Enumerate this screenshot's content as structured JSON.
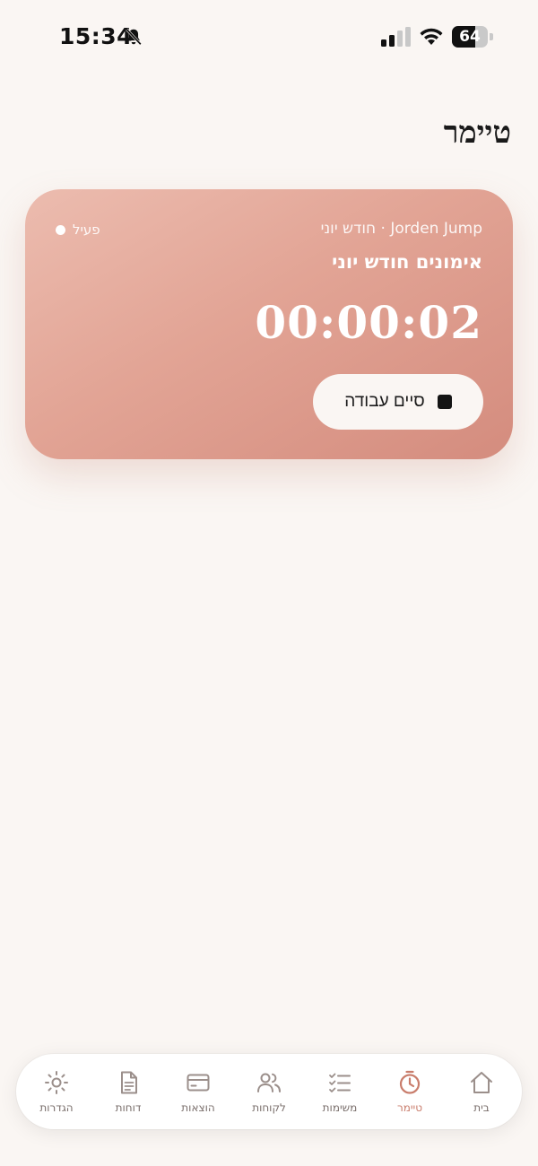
{
  "status_bar": {
    "time": "15:34",
    "battery_percent": 64,
    "battery_label": "64",
    "icons": [
      "bell-slash-icon",
      "cellular-signal-icon",
      "wifi-icon",
      "battery-icon"
    ]
  },
  "page": {
    "title": "טיימר"
  },
  "timer_card": {
    "status_label": "פעיל",
    "subtitle": "Jorden Jump · חודש יוני",
    "title": "אימונים חודש יוני",
    "elapsed": "00:00:02",
    "stop_button_label": "סיים עבודה",
    "stop_icon": "stop-icon"
  },
  "nav": {
    "items": [
      {
        "label": "בית",
        "icon": "home-icon",
        "active": false
      },
      {
        "label": "טיימר",
        "icon": "stopwatch-icon",
        "active": true
      },
      {
        "label": "משימות",
        "icon": "checklist-icon",
        "active": false
      },
      {
        "label": "לקוחות",
        "icon": "users-icon",
        "active": false
      },
      {
        "label": "הוצאות",
        "icon": "credit-card-icon",
        "active": false
      },
      {
        "label": "דוחות",
        "icon": "document-icon",
        "active": false
      },
      {
        "label": "הגדרות",
        "icon": "settings-sun-icon",
        "active": false
      }
    ]
  },
  "colors": {
    "background": "#faf6f3",
    "card_gradient_start": "#ecbcaf",
    "card_gradient_end": "#d48c7e",
    "accent": "#c97d6c",
    "nav_inactive": "#7a6f6c"
  }
}
